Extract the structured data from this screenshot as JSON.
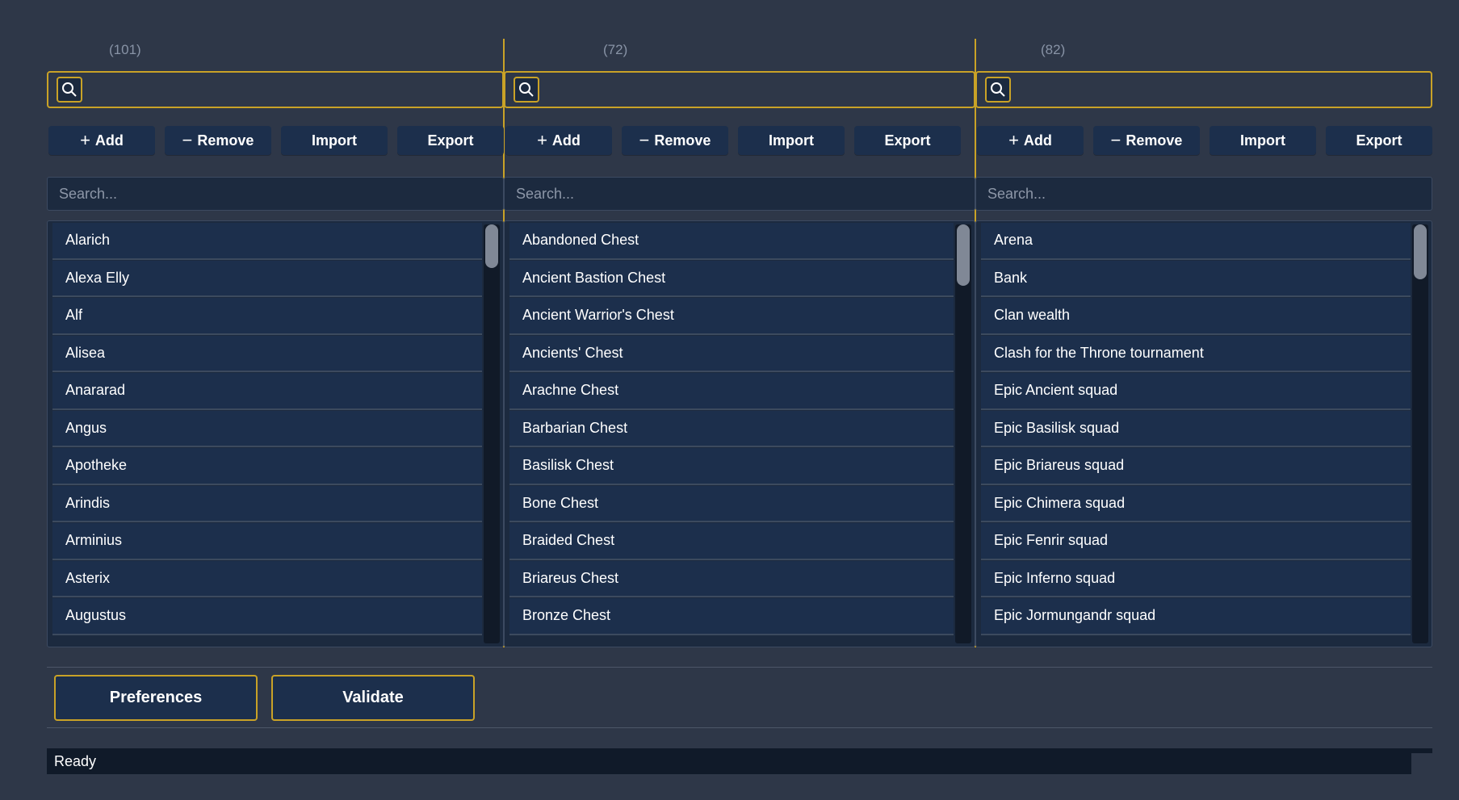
{
  "panels": [
    {
      "count": "(101)",
      "buttons": {
        "add": "Add",
        "remove": "Remove",
        "import": "Import",
        "export": "Export"
      },
      "search_placeholder": "Search...",
      "items": [
        "Alarich",
        "Alexa Elly",
        "Alf",
        "Alisea",
        "Anararad",
        "Angus",
        "Apotheke",
        "Arindis",
        "Arminius",
        "Asterix",
        "Augustus"
      ]
    },
    {
      "count": "(72)",
      "buttons": {
        "add": "Add",
        "remove": "Remove",
        "import": "Import",
        "export": "Export"
      },
      "search_placeholder": "Search...",
      "items": [
        "Abandoned Chest",
        "Ancient Bastion Chest",
        "Ancient Warrior's Chest",
        "Ancients' Chest",
        "Arachne Chest",
        "Barbarian Chest",
        "Basilisk Chest",
        "Bone Chest",
        "Braided Chest",
        "Briareus Chest",
        "Bronze Chest"
      ]
    },
    {
      "count": "(82)",
      "buttons": {
        "add": "Add",
        "remove": "Remove",
        "import": "Import",
        "export": "Export"
      },
      "search_placeholder": "Search...",
      "items": [
        "Arena",
        "Bank",
        "Clan wealth",
        "Clash for the Throne tournament",
        "Epic Ancient squad",
        "Epic Basilisk squad",
        "Epic Briareus squad",
        "Epic Chimera squad",
        "Epic Fenrir squad",
        "Epic Inferno squad",
        "Epic Jormungandr squad"
      ]
    }
  ],
  "footer": {
    "preferences": "Preferences",
    "validate": "Validate"
  },
  "status": "Ready",
  "colors": {
    "accent": "#c9a227",
    "background": "#2e3748",
    "panel": "#1c2f4c"
  }
}
